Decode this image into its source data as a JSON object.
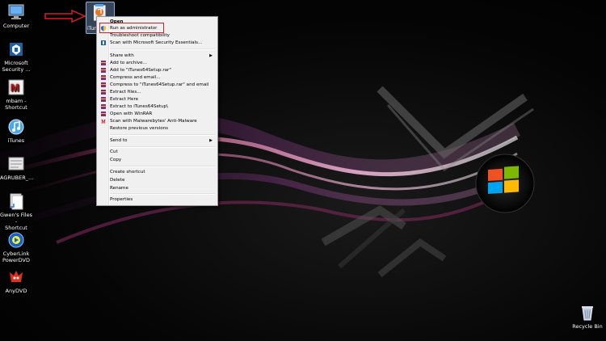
{
  "desktop_icons": [
    {
      "label": "Computer",
      "icon": "computer-icon"
    },
    {
      "label": "Microsoft\nSecurity ...",
      "icon": "security-essentials-icon"
    },
    {
      "label": "mbam -\nShortcut",
      "icon": "malwarebytes-icon"
    },
    {
      "label": "iTunes",
      "icon": "itunes-icon"
    },
    {
      "label": "AGRUBER_...",
      "icon": "folder-icon"
    },
    {
      "label": "Gwen's Files -\nShortcut",
      "icon": "files-icon"
    },
    {
      "label": "CyberLink\nPowerDVD",
      "icon": "powerdvd-icon"
    },
    {
      "label": "AnyDVD",
      "icon": "anydvd-icon"
    },
    {
      "label": "Recycle Bin",
      "icon": "recycle-bin-icon"
    }
  ],
  "selected_file": {
    "label": "iTun",
    "icon": "itunes-setup-icon"
  },
  "context_menu": {
    "items": [
      {
        "label": "Open",
        "bold": true
      },
      {
        "label": "Run as administrator",
        "icon": "shield-icon",
        "highlighted": true
      },
      {
        "label": "Troubleshoot compatibility"
      },
      {
        "label": "Scan with Microsoft Security Essentials...",
        "icon": "mse-icon"
      },
      {
        "label": "Share with",
        "submenu": true
      },
      {
        "label": "Add to archive...",
        "icon": "winrar-icon"
      },
      {
        "label": "Add to \"iTunes64Setup.rar\"",
        "icon": "winrar-icon"
      },
      {
        "label": "Compress and email...",
        "icon": "winrar-icon"
      },
      {
        "label": "Compress to \"iTunes64Setup.rar\" and email",
        "icon": "winrar-icon"
      },
      {
        "label": "Extract files...",
        "icon": "winrar-icon"
      },
      {
        "label": "Extract Here",
        "icon": "winrar-icon"
      },
      {
        "label": "Extract to iTunes64Setup\\",
        "icon": "winrar-icon"
      },
      {
        "label": "Open with WinRAR",
        "icon": "winrar-icon"
      },
      {
        "label": "Scan with Malwarebytes' Anti-Malware",
        "icon": "malwarebytes-icon"
      },
      {
        "label": "Restore previous versions"
      },
      {
        "label": "Send to",
        "submenu": true
      },
      {
        "label": "Cut"
      },
      {
        "label": "Copy"
      },
      {
        "label": "Create shortcut"
      },
      {
        "label": "Delete"
      },
      {
        "label": "Rename"
      },
      {
        "label": "Properties"
      }
    ]
  },
  "colors": {
    "highlight_border": "#d81f26",
    "arrow": "#d81f26"
  }
}
